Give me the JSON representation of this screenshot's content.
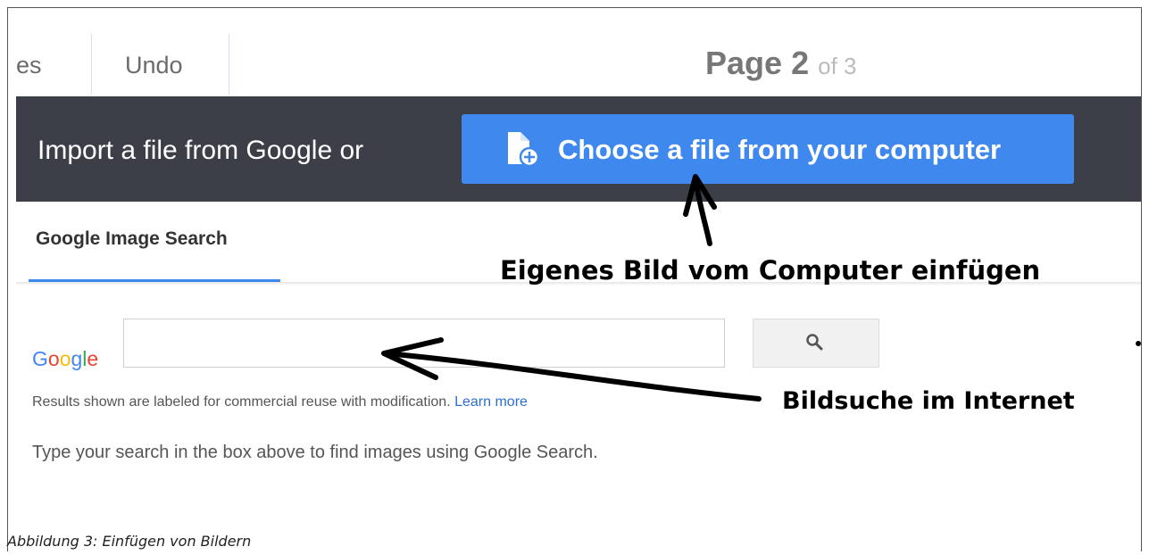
{
  "toolbar": {
    "partial_item_label": "es",
    "undo_label": "Undo",
    "page_indicator": {
      "prefix": "Page",
      "current": "2",
      "of_text": "of 3"
    }
  },
  "import_bar": {
    "text": "Import a file from Google or",
    "choose_button_label": "Choose a file from your computer",
    "choose_button_icon": "file-add-icon"
  },
  "tabs": [
    {
      "label": "Google Image Search",
      "active": true
    }
  ],
  "search": {
    "logo_letters": [
      "G",
      "o",
      "o",
      "g",
      "l",
      "e"
    ],
    "logo_colors": [
      "#4285f4",
      "#ea4335",
      "#fbbc05",
      "#4285f4",
      "#34a853",
      "#ea4335"
    ],
    "input_value": "",
    "button_icon": "search-icon",
    "results_note": "Results shown are labeled for commercial reuse with modification.",
    "learn_more_label": "Learn more",
    "instructions": "Type your search in the box above to find images using Google Search."
  },
  "annotations": {
    "upload_label": "Eigenes Bild vom Computer einfügen",
    "search_label": "Bildsuche im Internet"
  },
  "caption": "Abbildung 3: Einfügen von Bildern",
  "colors": {
    "accent": "#3f88ee",
    "dark_bar": "#3c3f48"
  }
}
